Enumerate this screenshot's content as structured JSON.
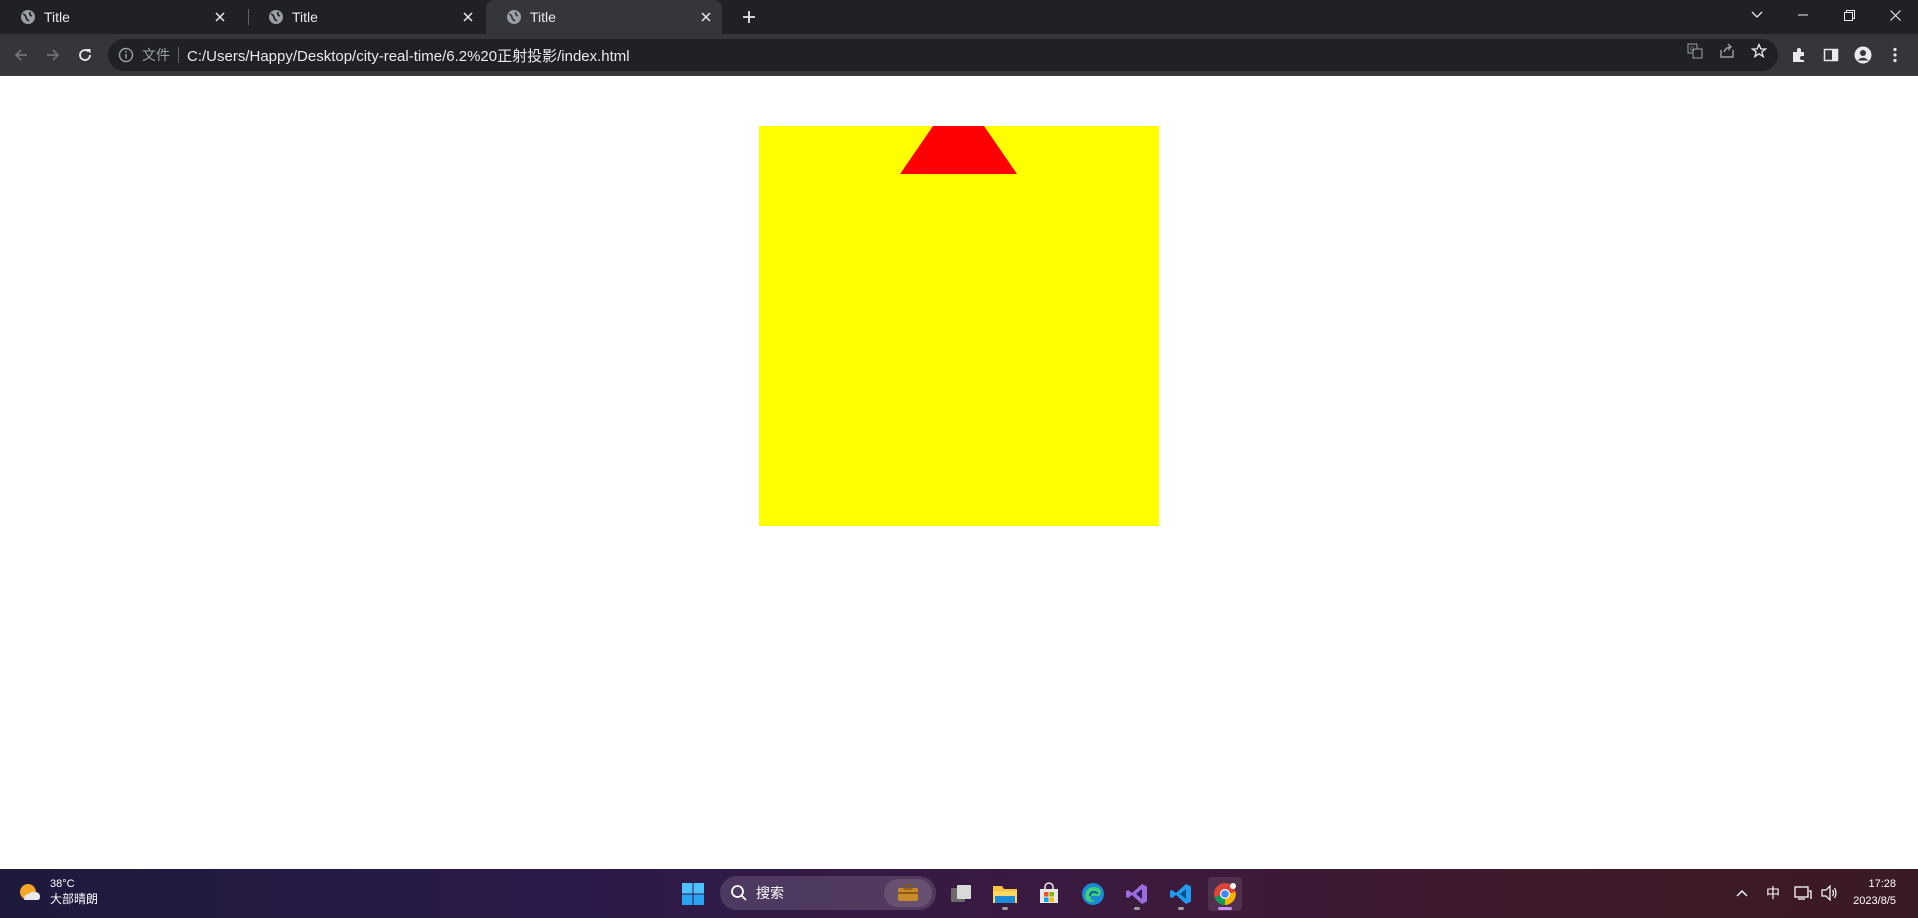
{
  "browser": {
    "tabs": [
      {
        "title": "Title",
        "icon": "globe-icon",
        "active": false
      },
      {
        "title": "Title",
        "icon": "globe-icon",
        "active": false
      },
      {
        "title": "Title",
        "icon": "globe-icon",
        "active": true
      }
    ],
    "omnibox": {
      "scheme_label": "文件",
      "url": "C:/Users/Happy/Desktop/city-real-time/6.2%20正射投影/index.html"
    }
  },
  "page": {
    "background": "#ffffff",
    "box_color": "#ffff00",
    "shape_color": "#ff0000"
  },
  "taskbar": {
    "weather": {
      "temp": "38°C",
      "desc": "大部晴朗"
    },
    "search_placeholder": "搜索",
    "apps": [
      "start-icon",
      "file-explorer-icon",
      "store-icon",
      "edge-icon",
      "visual-studio-icon",
      "vscode-icon",
      "chrome-icon"
    ],
    "tray": {
      "ime": "中"
    },
    "clock": {
      "time": "17:28",
      "date": "2023/8/5"
    }
  },
  "colors": {
    "tabstrip": "#202124",
    "toolbar": "#35363a",
    "accent": "#c98ef0"
  }
}
